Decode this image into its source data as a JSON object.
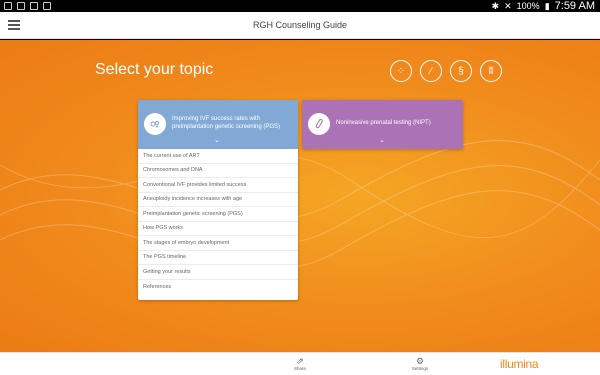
{
  "status_bar": {
    "battery": "100%",
    "time": "7:59 AM"
  },
  "header": {
    "title": "RGH Counseling Guide"
  },
  "main": {
    "title": "Select your topic",
    "topic_icons": [
      "cells-icon",
      "pipette-icon",
      "dna-icon",
      "chromosomes-icon"
    ]
  },
  "cards": {
    "pgs": {
      "label": "Improving IVF success rates with preimplantation genetic screening (PGS)",
      "items": [
        "The current use of ART",
        "Chromosomes and DNA",
        "Conventional IVF provides limited success",
        "Aneuploidy incidence increases with age",
        "Preimplantation genetic screening (PGS)",
        "How PGS works",
        "The stages of embryo development",
        "The PGS timeline",
        "Getting your results",
        "References"
      ]
    },
    "nipt": {
      "label": "Noninvasive prenatal testing (NIPT)"
    }
  },
  "footer": {
    "share": "Share",
    "settings": "Settings",
    "logo": "illumina"
  },
  "colors": {
    "orange": "#f08a1c",
    "blue_card": "#82a9d6",
    "purple_card": "#ab73b5"
  }
}
